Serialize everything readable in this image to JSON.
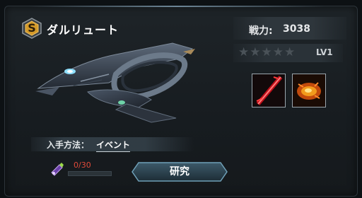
{
  "ship": {
    "rank": "S",
    "name": "ダルリュート",
    "power_label": "戦力:",
    "power_value": "3038",
    "stars_total": 5,
    "stars_filled": 0,
    "level": "LV1"
  },
  "skills": [
    {
      "icon": "red-slash-skill-icon"
    },
    {
      "icon": "fire-burst-skill-icon"
    }
  ],
  "acquisition": {
    "label": "入手方法：",
    "method": "イベント"
  },
  "research": {
    "progress_text": "0/30",
    "progress_fraction": 0.0,
    "button_label": "研究"
  },
  "colors": {
    "rank_badge": "#d49a2a",
    "progress_text": "#e04a3a",
    "button_border": "#6fa0b8"
  }
}
